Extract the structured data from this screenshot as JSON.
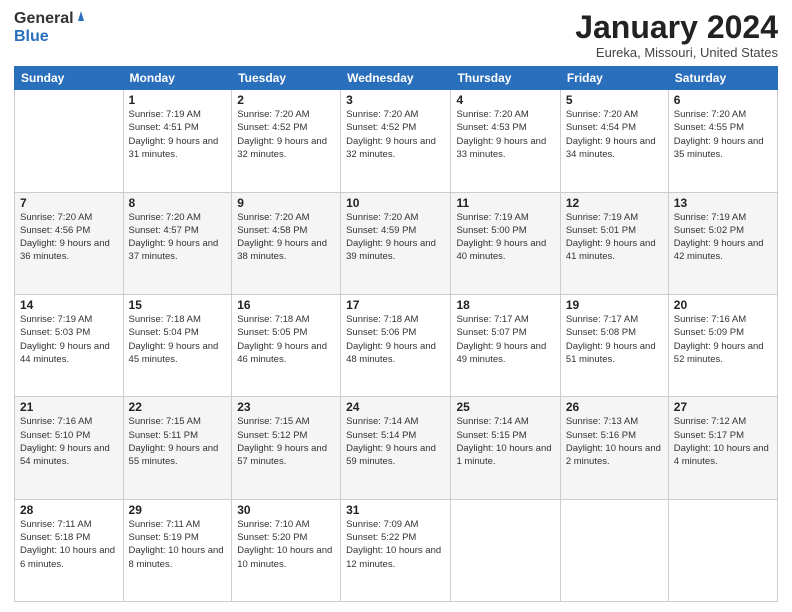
{
  "logo": {
    "general": "General",
    "blue": "Blue"
  },
  "header": {
    "title": "January 2024",
    "location": "Eureka, Missouri, United States"
  },
  "days_of_week": [
    "Sunday",
    "Monday",
    "Tuesday",
    "Wednesday",
    "Thursday",
    "Friday",
    "Saturday"
  ],
  "weeks": [
    [
      {
        "day": "",
        "sunrise": "",
        "sunset": "",
        "daylight": ""
      },
      {
        "day": "1",
        "sunrise": "Sunrise: 7:19 AM",
        "sunset": "Sunset: 4:51 PM",
        "daylight": "Daylight: 9 hours and 31 minutes."
      },
      {
        "day": "2",
        "sunrise": "Sunrise: 7:20 AM",
        "sunset": "Sunset: 4:52 PM",
        "daylight": "Daylight: 9 hours and 32 minutes."
      },
      {
        "day": "3",
        "sunrise": "Sunrise: 7:20 AM",
        "sunset": "Sunset: 4:52 PM",
        "daylight": "Daylight: 9 hours and 32 minutes."
      },
      {
        "day": "4",
        "sunrise": "Sunrise: 7:20 AM",
        "sunset": "Sunset: 4:53 PM",
        "daylight": "Daylight: 9 hours and 33 minutes."
      },
      {
        "day": "5",
        "sunrise": "Sunrise: 7:20 AM",
        "sunset": "Sunset: 4:54 PM",
        "daylight": "Daylight: 9 hours and 34 minutes."
      },
      {
        "day": "6",
        "sunrise": "Sunrise: 7:20 AM",
        "sunset": "Sunset: 4:55 PM",
        "daylight": "Daylight: 9 hours and 35 minutes."
      }
    ],
    [
      {
        "day": "7",
        "sunrise": "Sunrise: 7:20 AM",
        "sunset": "Sunset: 4:56 PM",
        "daylight": "Daylight: 9 hours and 36 minutes."
      },
      {
        "day": "8",
        "sunrise": "Sunrise: 7:20 AM",
        "sunset": "Sunset: 4:57 PM",
        "daylight": "Daylight: 9 hours and 37 minutes."
      },
      {
        "day": "9",
        "sunrise": "Sunrise: 7:20 AM",
        "sunset": "Sunset: 4:58 PM",
        "daylight": "Daylight: 9 hours and 38 minutes."
      },
      {
        "day": "10",
        "sunrise": "Sunrise: 7:20 AM",
        "sunset": "Sunset: 4:59 PM",
        "daylight": "Daylight: 9 hours and 39 minutes."
      },
      {
        "day": "11",
        "sunrise": "Sunrise: 7:19 AM",
        "sunset": "Sunset: 5:00 PM",
        "daylight": "Daylight: 9 hours and 40 minutes."
      },
      {
        "day": "12",
        "sunrise": "Sunrise: 7:19 AM",
        "sunset": "Sunset: 5:01 PM",
        "daylight": "Daylight: 9 hours and 41 minutes."
      },
      {
        "day": "13",
        "sunrise": "Sunrise: 7:19 AM",
        "sunset": "Sunset: 5:02 PM",
        "daylight": "Daylight: 9 hours and 42 minutes."
      }
    ],
    [
      {
        "day": "14",
        "sunrise": "Sunrise: 7:19 AM",
        "sunset": "Sunset: 5:03 PM",
        "daylight": "Daylight: 9 hours and 44 minutes."
      },
      {
        "day": "15",
        "sunrise": "Sunrise: 7:18 AM",
        "sunset": "Sunset: 5:04 PM",
        "daylight": "Daylight: 9 hours and 45 minutes."
      },
      {
        "day": "16",
        "sunrise": "Sunrise: 7:18 AM",
        "sunset": "Sunset: 5:05 PM",
        "daylight": "Daylight: 9 hours and 46 minutes."
      },
      {
        "day": "17",
        "sunrise": "Sunrise: 7:18 AM",
        "sunset": "Sunset: 5:06 PM",
        "daylight": "Daylight: 9 hours and 48 minutes."
      },
      {
        "day": "18",
        "sunrise": "Sunrise: 7:17 AM",
        "sunset": "Sunset: 5:07 PM",
        "daylight": "Daylight: 9 hours and 49 minutes."
      },
      {
        "day": "19",
        "sunrise": "Sunrise: 7:17 AM",
        "sunset": "Sunset: 5:08 PM",
        "daylight": "Daylight: 9 hours and 51 minutes."
      },
      {
        "day": "20",
        "sunrise": "Sunrise: 7:16 AM",
        "sunset": "Sunset: 5:09 PM",
        "daylight": "Daylight: 9 hours and 52 minutes."
      }
    ],
    [
      {
        "day": "21",
        "sunrise": "Sunrise: 7:16 AM",
        "sunset": "Sunset: 5:10 PM",
        "daylight": "Daylight: 9 hours and 54 minutes."
      },
      {
        "day": "22",
        "sunrise": "Sunrise: 7:15 AM",
        "sunset": "Sunset: 5:11 PM",
        "daylight": "Daylight: 9 hours and 55 minutes."
      },
      {
        "day": "23",
        "sunrise": "Sunrise: 7:15 AM",
        "sunset": "Sunset: 5:12 PM",
        "daylight": "Daylight: 9 hours and 57 minutes."
      },
      {
        "day": "24",
        "sunrise": "Sunrise: 7:14 AM",
        "sunset": "Sunset: 5:14 PM",
        "daylight": "Daylight: 9 hours and 59 minutes."
      },
      {
        "day": "25",
        "sunrise": "Sunrise: 7:14 AM",
        "sunset": "Sunset: 5:15 PM",
        "daylight": "Daylight: 10 hours and 1 minute."
      },
      {
        "day": "26",
        "sunrise": "Sunrise: 7:13 AM",
        "sunset": "Sunset: 5:16 PM",
        "daylight": "Daylight: 10 hours and 2 minutes."
      },
      {
        "day": "27",
        "sunrise": "Sunrise: 7:12 AM",
        "sunset": "Sunset: 5:17 PM",
        "daylight": "Daylight: 10 hours and 4 minutes."
      }
    ],
    [
      {
        "day": "28",
        "sunrise": "Sunrise: 7:11 AM",
        "sunset": "Sunset: 5:18 PM",
        "daylight": "Daylight: 10 hours and 6 minutes."
      },
      {
        "day": "29",
        "sunrise": "Sunrise: 7:11 AM",
        "sunset": "Sunset: 5:19 PM",
        "daylight": "Daylight: 10 hours and 8 minutes."
      },
      {
        "day": "30",
        "sunrise": "Sunrise: 7:10 AM",
        "sunset": "Sunset: 5:20 PM",
        "daylight": "Daylight: 10 hours and 10 minutes."
      },
      {
        "day": "31",
        "sunrise": "Sunrise: 7:09 AM",
        "sunset": "Sunset: 5:22 PM",
        "daylight": "Daylight: 10 hours and 12 minutes."
      },
      {
        "day": "",
        "sunrise": "",
        "sunset": "",
        "daylight": ""
      },
      {
        "day": "",
        "sunrise": "",
        "sunset": "",
        "daylight": ""
      },
      {
        "day": "",
        "sunrise": "",
        "sunset": "",
        "daylight": ""
      }
    ]
  ]
}
